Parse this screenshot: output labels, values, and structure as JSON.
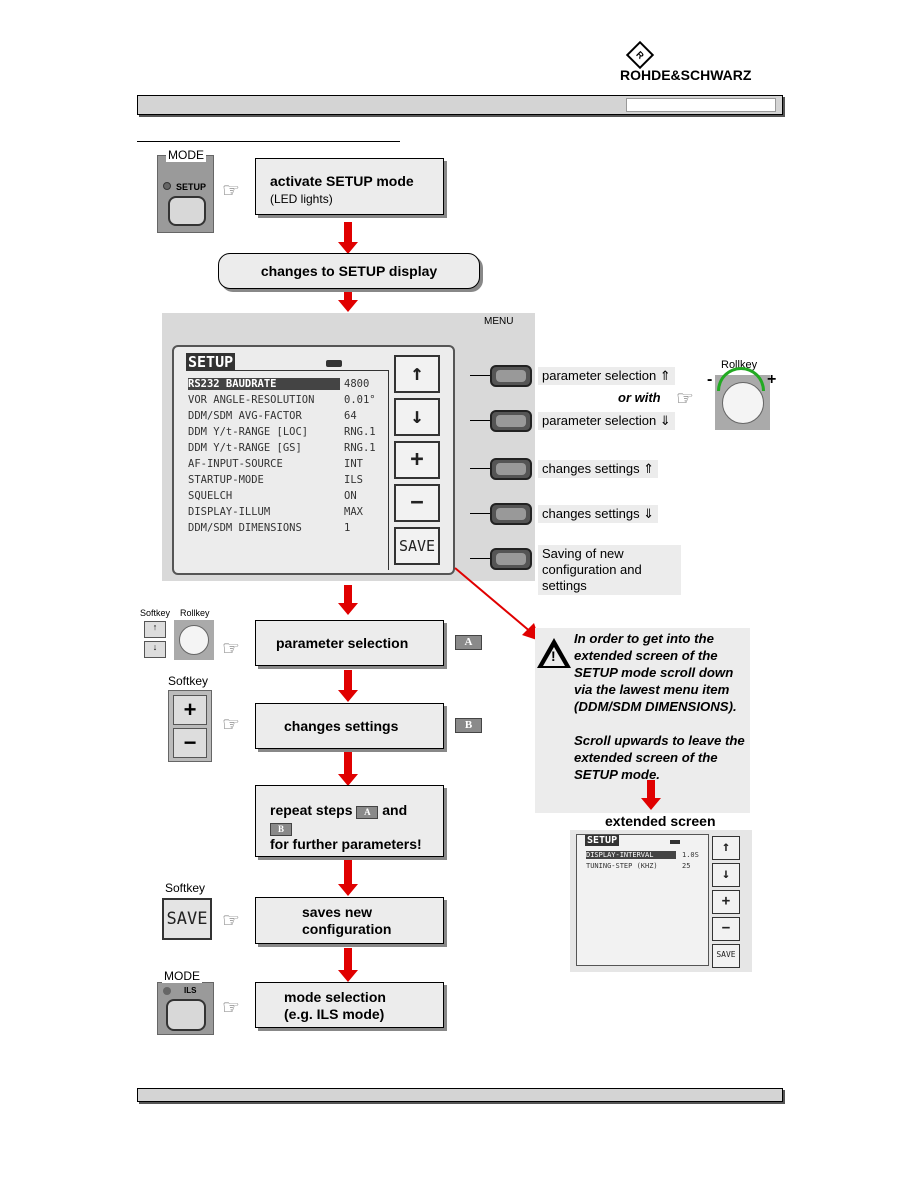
{
  "logo": {
    "brand": "ROHDE&SCHWARZ"
  },
  "flow": {
    "mode_label": "MODE",
    "setup_key": "SETUP",
    "step1": {
      "title": "activate SETUP mode",
      "sub": "(LED lights)"
    },
    "step2": "changes to SETUP display",
    "menu_label": "MENU",
    "screen": {
      "title": "SETUP",
      "rows": [
        {
          "name": "RS232 BAUDRATE",
          "value": "4800"
        },
        {
          "name": "VOR ANGLE-RESOLUTION",
          "value": "0.01°"
        },
        {
          "name": "DDM/SDM AVG-FACTOR",
          "value": "64"
        },
        {
          "name": "DDM Y/t-RANGE [LOC]",
          "value": "RNG.1"
        },
        {
          "name": "DDM Y/t-RANGE [GS]",
          "value": "RNG.1"
        },
        {
          "name": "AF-INPUT-SOURCE",
          "value": "INT"
        },
        {
          "name": "STARTUP-MODE",
          "value": "ILS"
        },
        {
          "name": "SQUELCH",
          "value": "ON"
        },
        {
          "name": "DISPLAY-ILLUM",
          "value": "MAX"
        },
        {
          "name": "DDM/SDM DIMENSIONS",
          "value": "1"
        }
      ],
      "softkeys": [
        "↑",
        "↓",
        "+",
        "−",
        "SAVE"
      ]
    },
    "key_labels": [
      "parameter selection   ⇑",
      "parameter selection   ⇓",
      "changes settings   ⇑",
      "changes settings   ⇓",
      "Saving of new configuration and settings"
    ],
    "or_with": "or with",
    "rollkey": "Rollkey",
    "softkey": "Softkey",
    "minus": "-",
    "plus": "+",
    "step3": "parameter selection",
    "badge_a": "A",
    "step4": "changes settings",
    "badge_b": "B",
    "step5": {
      "pre": "repeat steps",
      "and": "and",
      "post": "for further parameters!"
    },
    "save_key": "SAVE",
    "step6": "saves new configuration",
    "ils_key": "ILS",
    "step7": {
      "title": "mode selection",
      "sub": "(e.g. ILS mode)"
    }
  },
  "note": {
    "text1": "In order to get into the extended screen of the SETUP mode scroll down via the lawest menu item (DDM/SDM DIMENSIONS).",
    "text2": "Scroll upwards to leave the extended screen of the SETUP mode.",
    "ext_title": "extended screen",
    "ext_screen": {
      "title": "SETUP",
      "rows": [
        {
          "name": "DISPLAY-INTERVAL",
          "value": "1.0S"
        },
        {
          "name": "TUNING-STEP (KHZ)",
          "value": "25"
        }
      ],
      "softkeys": [
        "↑",
        "↓",
        "+",
        "−",
        "SAVE"
      ]
    }
  }
}
